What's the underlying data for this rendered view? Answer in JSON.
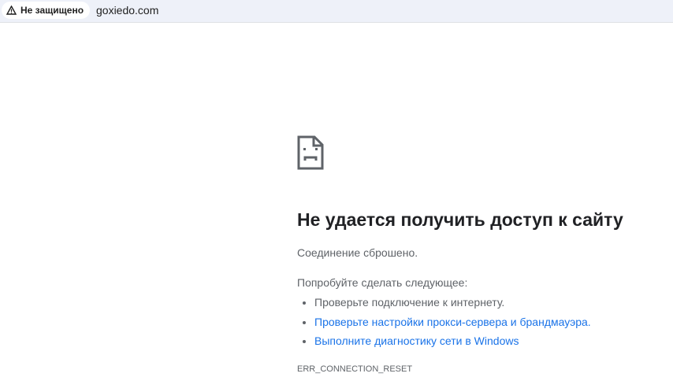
{
  "address_bar": {
    "security_label": "Не защищено",
    "url": "goxiedo.com"
  },
  "error": {
    "title": "Не удается получить доступ к сайту",
    "subtitle": "Соединение сброшено.",
    "try_label": "Попробуйте сделать следующее:",
    "suggestions": [
      "Проверьте подключение к интернету.",
      "Проверьте настройки прокси-сервера и брандмауэра.",
      "Выполните диагностику сети в Windows"
    ],
    "code": "ERR_CONNECTION_RESET"
  }
}
